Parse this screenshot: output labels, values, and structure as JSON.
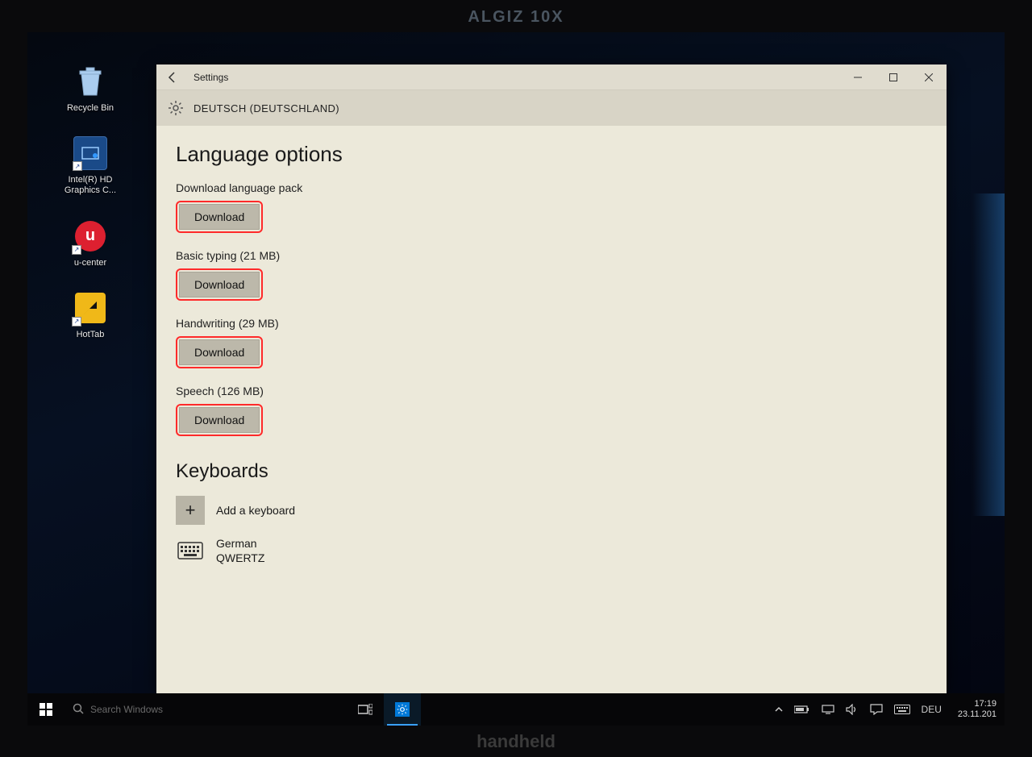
{
  "device": {
    "brand_top": "ALGIZ 10X",
    "brand_bottom": "handheld"
  },
  "desktop": {
    "icons": [
      {
        "name": "recycle-bin",
        "label": "Recycle Bin"
      },
      {
        "name": "intel-hd-graphics",
        "label": "Intel(R) HD\nGraphics C..."
      },
      {
        "name": "u-center",
        "label": "u-center"
      },
      {
        "name": "hottab",
        "label": "HotTab"
      }
    ]
  },
  "window": {
    "app_name": "Settings",
    "page_header": "DEUTSCH (DEUTSCHLAND)",
    "section_title": "Language options",
    "options": [
      {
        "label": "Download language pack",
        "button": "Download"
      },
      {
        "label": "Basic typing (21 MB)",
        "button": "Download"
      },
      {
        "label": "Handwriting (29 MB)",
        "button": "Download"
      },
      {
        "label": "Speech (126 MB)",
        "button": "Download"
      }
    ],
    "keyboards_title": "Keyboards",
    "add_keyboard": "Add a keyboard",
    "keyboards": [
      {
        "name": "German",
        "layout": "QWERTZ"
      }
    ]
  },
  "taskbar": {
    "search_placeholder": "Search Windows",
    "lang": "DEU",
    "time": "17:19",
    "date": "23.11.201"
  }
}
